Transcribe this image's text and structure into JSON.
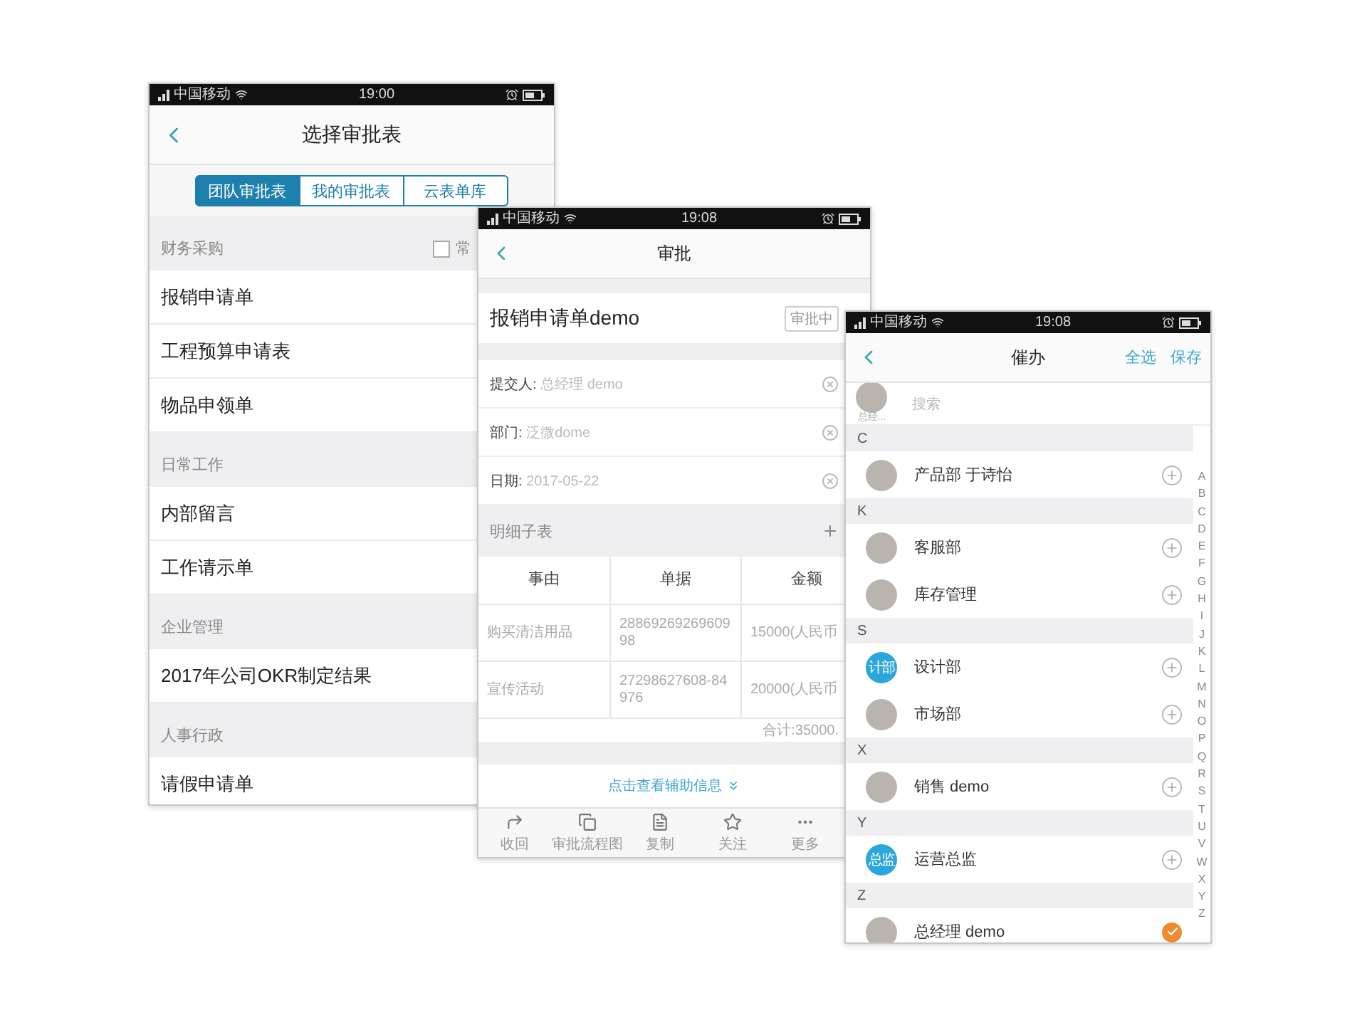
{
  "select_form_screen": {
    "status_bar": {
      "carrier": "中国移动",
      "time": "19:00"
    },
    "title": "选择审批表",
    "tabs": [
      {
        "label": "团队审批表",
        "selected": true
      },
      {
        "label": "我的审批表",
        "selected": false
      },
      {
        "label": "云表单库",
        "selected": false
      }
    ],
    "sections": [
      {
        "title": "财务采购",
        "checkbox": {
          "label": "常",
          "checked": false
        },
        "items": [
          "报销申请单",
          "工程预算申请表",
          "物品申领单"
        ]
      },
      {
        "title": "日常工作",
        "items": [
          "内部留言",
          "工作请示单"
        ]
      },
      {
        "title": "企业管理",
        "items": [
          "2017年公司OKR制定结果"
        ]
      },
      {
        "title": "人事行政",
        "items": [
          "请假申请单"
        ]
      }
    ]
  },
  "approval_screen": {
    "status_bar": {
      "carrier": "中国移动",
      "time": "19:08"
    },
    "title": "审批",
    "form_title": "报销申请单demo",
    "status_badge": "审批中",
    "fields": [
      {
        "label": "提交人:",
        "value": "总经理 demo"
      },
      {
        "label": "部门:",
        "value": "泛微dome"
      },
      {
        "label": "日期:",
        "value": "2017-05-22"
      }
    ],
    "detail_title": "明细子表",
    "table": {
      "columns": [
        "事由",
        "单据",
        "金额"
      ],
      "rows": [
        [
          "购买清洁用品",
          "2886926926960998",
          "15000(人民币"
        ],
        [
          "宣传活动",
          "27298627608-84976",
          "20000(人民币"
        ]
      ],
      "total": "合计:35000."
    },
    "more_link": "点击查看辅助信息",
    "toolbar": [
      {
        "kind": "recall",
        "label": "收回"
      },
      {
        "kind": "flow",
        "label": "审批流程图"
      },
      {
        "kind": "copy",
        "label": "复制"
      },
      {
        "kind": "follow",
        "label": "关注"
      },
      {
        "kind": "more",
        "label": "更多"
      }
    ]
  },
  "reminder_screen": {
    "status_bar": {
      "carrier": "中国移动",
      "time": "19:08"
    },
    "title": "催办",
    "actions": [
      "全选",
      "保存"
    ],
    "search": {
      "placeholder": "搜索",
      "picked_label": "总经..."
    },
    "groups": [
      {
        "letter": "C",
        "contacts": [
          {
            "name": "产品部 于诗怡",
            "kind": "photo",
            "selected": false
          }
        ]
      },
      {
        "letter": "K",
        "contacts": [
          {
            "name": "客服部",
            "kind": "photo",
            "selected": false
          },
          {
            "name": "库存管理",
            "kind": "photo",
            "selected": false
          }
        ]
      },
      {
        "letter": "S",
        "contacts": [
          {
            "name": "设计部",
            "kind": "badge",
            "avatar_text": "计部",
            "selected": false
          },
          {
            "name": "市场部",
            "kind": "photo",
            "selected": false
          }
        ]
      },
      {
        "letter": "X",
        "contacts": [
          {
            "name": "销售 demo",
            "kind": "photo",
            "selected": false
          }
        ]
      },
      {
        "letter": "Y",
        "contacts": [
          {
            "name": "运营总监",
            "kind": "badge",
            "avatar_text": "总监",
            "selected": false
          }
        ]
      },
      {
        "letter": "Z",
        "contacts": [
          {
            "name": "总经理 demo",
            "kind": "photo",
            "selected": true
          }
        ]
      }
    ],
    "index": [
      "A",
      "B",
      "C",
      "D",
      "E",
      "F",
      "G",
      "H",
      "I",
      "J",
      "K",
      "L",
      "M",
      "N",
      "O",
      "P",
      "Q",
      "R",
      "S",
      "T",
      "U",
      "V",
      "W",
      "X",
      "Y",
      "Z"
    ]
  }
}
